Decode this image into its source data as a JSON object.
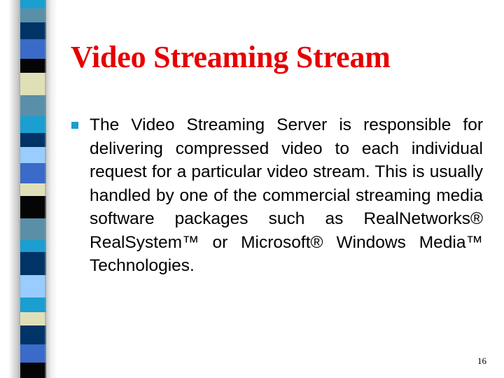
{
  "slide": {
    "title": "Video Streaming Stream",
    "title_color": "#e60000",
    "bullets": [
      {
        "icon": "square-bullet-icon",
        "color": "#1a9fd0",
        "text": "The Video Streaming Server is responsible for delivering compressed video to each individual request for a particular video stream. This is usually handled by one of the commercial streaming media software packages such as RealNetworks® RealSystem™ or Microsoft® Windows Media™ Technologies."
      }
    ],
    "page_number": "16"
  },
  "decor": {
    "band_colors": {
      "cyan": "#1a9fd0",
      "steel": "#5a8fa8",
      "navy": "#003366",
      "royal": "#3a6bc8",
      "black": "#050505",
      "beige": "#e0e0b8",
      "light": "#99ccff"
    },
    "stripe_sequence": [
      "cyan",
      "steel",
      "navy",
      "royal",
      "black",
      "beige",
      "steel",
      "cyan",
      "navy",
      "light",
      "royal",
      "beige",
      "black",
      "steel",
      "cyan",
      "navy",
      "light",
      "cyan",
      "beige",
      "navy",
      "royal",
      "black"
    ]
  }
}
